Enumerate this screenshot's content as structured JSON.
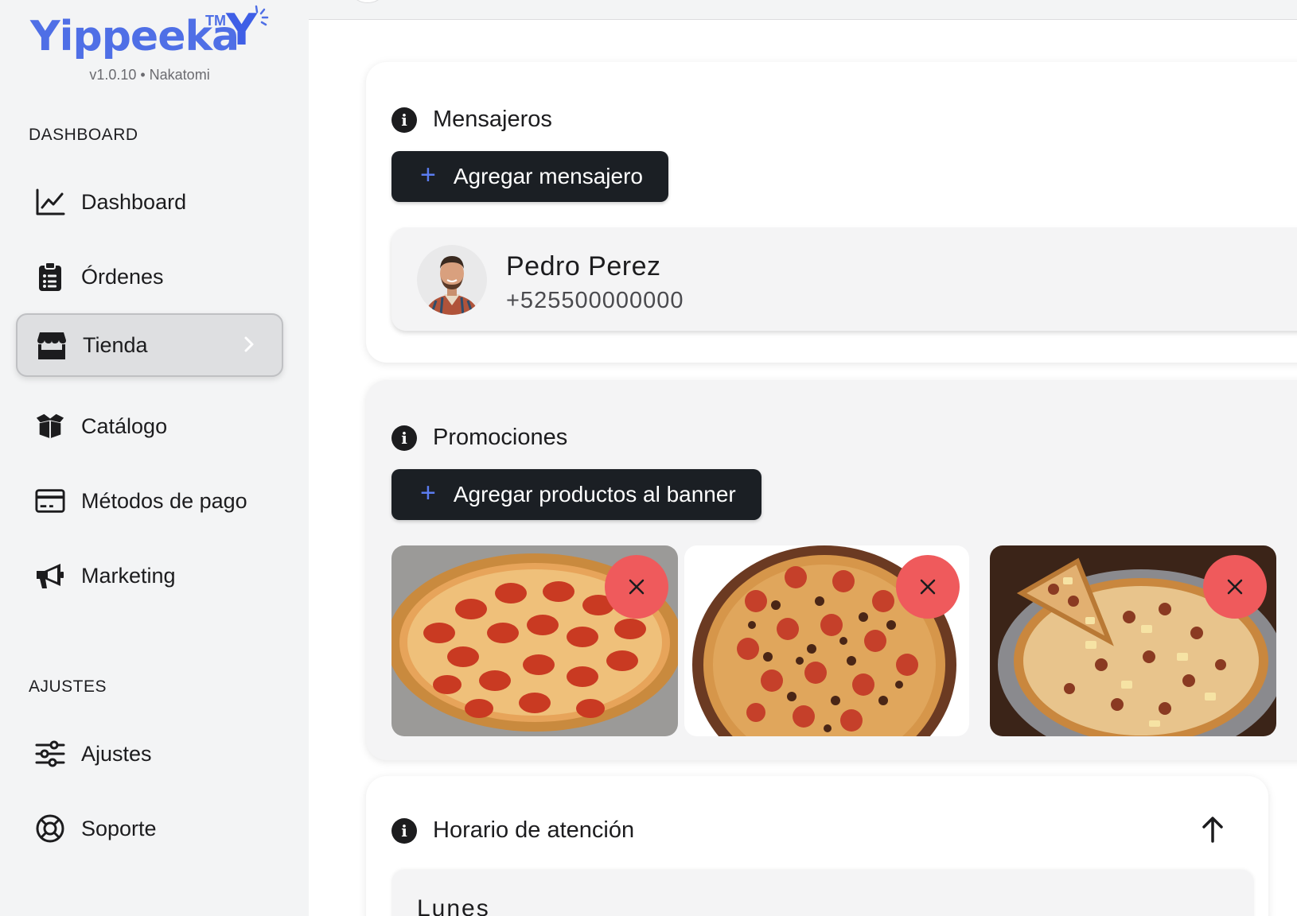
{
  "brand": {
    "name": "Yippeeka",
    "tm": "TM",
    "mark": "Y",
    "version": "v1.0.10 • Nakatomi",
    "color": "#4f6fe6"
  },
  "sidebar": {
    "section_dashboard": "DASHBOARD",
    "section_settings": "AJUSTES",
    "items": [
      {
        "label": "Dashboard",
        "icon": "line-chart-icon",
        "active": false
      },
      {
        "label": "Órdenes",
        "icon": "clipboard-list-icon",
        "active": false
      },
      {
        "label": "Tienda",
        "icon": "store-icon",
        "active": true
      },
      {
        "label": "Catálogo",
        "icon": "open-box-icon",
        "active": false
      },
      {
        "label": "Métodos de pago",
        "icon": "credit-card-icon",
        "active": false
      },
      {
        "label": "Marketing",
        "icon": "megaphone-icon",
        "active": false
      }
    ],
    "settings_items": [
      {
        "label": "Ajustes",
        "icon": "sliders-icon"
      },
      {
        "label": "Soporte",
        "icon": "lifebuoy-icon"
      }
    ]
  },
  "couriers": {
    "title": "Mensajeros",
    "add_label": "Agregar mensajero",
    "list": [
      {
        "name": "Pedro Perez",
        "phone": "+525500000000"
      }
    ]
  },
  "promotions": {
    "title": "Promociones",
    "add_label": "Agregar productos al banner",
    "items": [
      {
        "image": "pepperoni-pizza"
      },
      {
        "image": "meat-lovers-pizza"
      },
      {
        "image": "hawaiian-pizza"
      }
    ],
    "remove_color": "#ef5a5c"
  },
  "hours": {
    "title": "Horario de atención",
    "days": [
      "Lunes"
    ]
  },
  "accent": "#5b7cf0",
  "button_dark": "#1b1f24"
}
